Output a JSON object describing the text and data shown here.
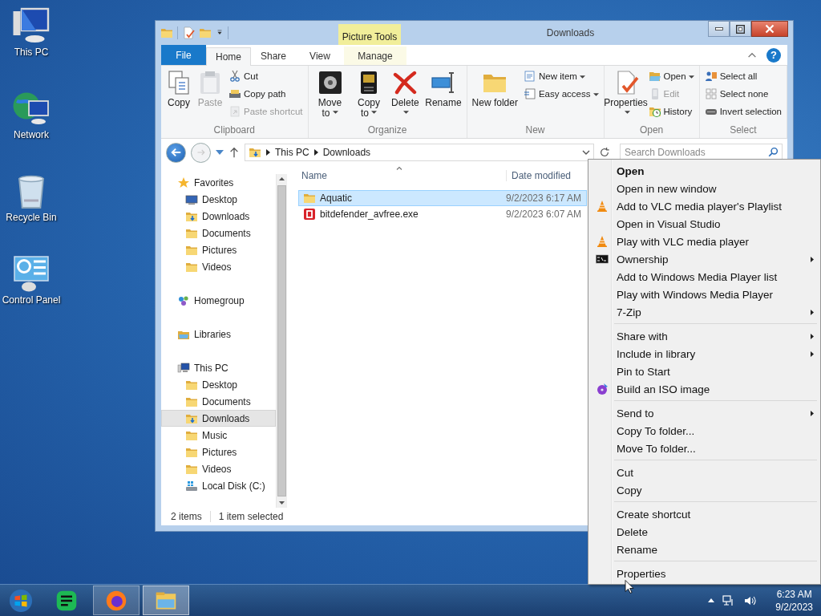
{
  "desktop_icons": [
    {
      "label": "This PC"
    },
    {
      "label": "Network"
    },
    {
      "label": "Recycle Bin"
    },
    {
      "label": "Control Panel"
    }
  ],
  "window": {
    "title": "Downloads",
    "contextual_group": "Picture Tools",
    "help_button": "?"
  },
  "ribbon_tabs": [
    {
      "label": "File",
      "kind": "file",
      "selected": false
    },
    {
      "label": "Home",
      "kind": "normal",
      "selected": true
    },
    {
      "label": "Share",
      "kind": "normal",
      "selected": false
    },
    {
      "label": "View",
      "kind": "normal",
      "selected": false
    },
    {
      "label": "Manage",
      "kind": "contextual",
      "selected": false
    }
  ],
  "ribbon_groups": [
    {
      "name": "Clipboard",
      "commands": [
        {
          "label": "Copy",
          "kind": "large",
          "disabled": false,
          "dropdown": false
        },
        {
          "label": "Paste",
          "kind": "large",
          "disabled": true,
          "dropdown": false
        },
        {
          "label": "Cut",
          "kind": "small",
          "disabled": false,
          "dropdown": false
        },
        {
          "label": "Copy path",
          "kind": "small",
          "disabled": false,
          "dropdown": false
        },
        {
          "label": "Paste shortcut",
          "kind": "small",
          "disabled": true,
          "dropdown": false
        }
      ]
    },
    {
      "name": "Organize",
      "commands": [
        {
          "label": "Move to",
          "kind": "large",
          "disabled": false,
          "dropdown": true
        },
        {
          "label": "Copy to",
          "kind": "large",
          "disabled": false,
          "dropdown": true
        },
        {
          "label": "Delete",
          "kind": "large",
          "disabled": false,
          "dropdown": true
        },
        {
          "label": "Rename",
          "kind": "large",
          "disabled": false,
          "dropdown": false
        }
      ]
    },
    {
      "name": "New",
      "commands": [
        {
          "label": "New folder",
          "kind": "large",
          "disabled": false,
          "dropdown": false
        },
        {
          "label": "New item",
          "kind": "small",
          "disabled": false,
          "dropdown": true
        },
        {
          "label": "Easy access",
          "kind": "small",
          "disabled": false,
          "dropdown": true
        }
      ]
    },
    {
      "name": "Open",
      "commands": [
        {
          "label": "Properties",
          "kind": "large",
          "disabled": false,
          "dropdown": true
        },
        {
          "label": "Open",
          "kind": "small",
          "disabled": false,
          "dropdown": true
        },
        {
          "label": "Edit",
          "kind": "small",
          "disabled": true,
          "dropdown": false
        },
        {
          "label": "History",
          "kind": "small",
          "disabled": false,
          "dropdown": false
        }
      ]
    },
    {
      "name": "Select",
      "commands": [
        {
          "label": "Select all",
          "kind": "small",
          "disabled": false,
          "dropdown": false
        },
        {
          "label": "Select none",
          "kind": "small",
          "disabled": false,
          "dropdown": false
        },
        {
          "label": "Invert selection",
          "kind": "small",
          "disabled": false,
          "dropdown": false
        }
      ]
    }
  ],
  "address_bar": {
    "segments": [
      "This PC",
      "Downloads"
    ]
  },
  "search": {
    "placeholder": "Search Downloads"
  },
  "navigation": [
    {
      "label": "Favorites",
      "kind": "star",
      "selected": false,
      "children": [
        {
          "label": "Desktop",
          "kind": "monitor",
          "selected": false
        },
        {
          "label": "Downloads",
          "kind": "download",
          "selected": false
        },
        {
          "label": "Documents",
          "kind": "folder",
          "selected": false
        },
        {
          "label": "Pictures",
          "kind": "folder",
          "selected": false
        },
        {
          "label": "Videos",
          "kind": "folder",
          "selected": false
        }
      ]
    },
    {
      "label": "Homegroup",
      "kind": "homegroup",
      "selected": false
    },
    {
      "label": "Libraries",
      "kind": "library",
      "selected": false
    },
    {
      "label": "This PC",
      "kind": "computer",
      "selected": false,
      "children": [
        {
          "label": "Desktop",
          "kind": "folder",
          "selected": false
        },
        {
          "label": "Documents",
          "kind": "folder",
          "selected": false
        },
        {
          "label": "Downloads",
          "kind": "download",
          "selected": true
        },
        {
          "label": "Music",
          "kind": "folder",
          "selected": false
        },
        {
          "label": "Pictures",
          "kind": "folder",
          "selected": false
        },
        {
          "label": "Videos",
          "kind": "folder",
          "selected": false
        },
        {
          "label": "Local Disk (C:)",
          "kind": "disk",
          "selected": false
        }
      ]
    }
  ],
  "columns": [
    "Name",
    "Date modified"
  ],
  "files": [
    {
      "name": "Aquatic",
      "kind": "folder",
      "date_modified": "9/2/2023 6:17 AM",
      "selected": true
    },
    {
      "name": "bitdefender_avfree.exe",
      "kind": "application",
      "date_modified": "9/2/2023 6:07 AM",
      "selected": false
    }
  ],
  "status_bar": {
    "count": "2 items",
    "selection": "1 item selected"
  },
  "context_menu": {
    "sections": [
      [
        {
          "label": "Open",
          "default": true,
          "submenu": false
        },
        {
          "label": "Open in new window",
          "default": false,
          "submenu": false
        },
        {
          "label": "Add to VLC media player's Playlist",
          "kind": "cone",
          "default": false,
          "submenu": false
        },
        {
          "label": "Open in Visual Studio",
          "default": false,
          "submenu": false
        },
        {
          "label": "Play with VLC media player",
          "kind": "cone",
          "default": false,
          "submenu": false
        },
        {
          "label": "Ownership",
          "kind": "console",
          "default": false,
          "submenu": true
        },
        {
          "label": "Add to Windows Media Player list",
          "default": false,
          "submenu": false
        },
        {
          "label": "Play with Windows Media Player",
          "default": false,
          "submenu": false
        },
        {
          "label": "7-Zip",
          "default": false,
          "submenu": true
        }
      ],
      [
        {
          "label": "Share with",
          "default": false,
          "submenu": true
        },
        {
          "label": "Include in library",
          "default": false,
          "submenu": true
        },
        {
          "label": "Pin to Start",
          "default": false,
          "submenu": false
        },
        {
          "label": "Build an ISO image",
          "kind": "disc",
          "default": false,
          "submenu": false
        }
      ],
      [
        {
          "label": "Send to",
          "default": false,
          "submenu": true
        },
        {
          "label": "Copy To folder...",
          "default": false,
          "submenu": false
        },
        {
          "label": "Move To folder...",
          "default": false,
          "submenu": false
        }
      ],
      [
        {
          "label": "Cut",
          "default": false,
          "submenu": false
        },
        {
          "label": "Copy",
          "default": false,
          "submenu": false
        }
      ],
      [
        {
          "label": "Create shortcut",
          "default": false,
          "submenu": false
        },
        {
          "label": "Delete",
          "default": false,
          "submenu": false
        },
        {
          "label": "Rename",
          "default": false,
          "submenu": false
        }
      ],
      [
        {
          "label": "Properties",
          "default": false,
          "submenu": false
        }
      ]
    ]
  },
  "taskbar": {
    "apps": [
      {
        "running": false,
        "active": false
      },
      {
        "running": true,
        "active": false
      },
      {
        "running": true,
        "active": true
      }
    ],
    "clock": {
      "time": "6:23 AM",
      "date": "9/2/2023"
    }
  }
}
